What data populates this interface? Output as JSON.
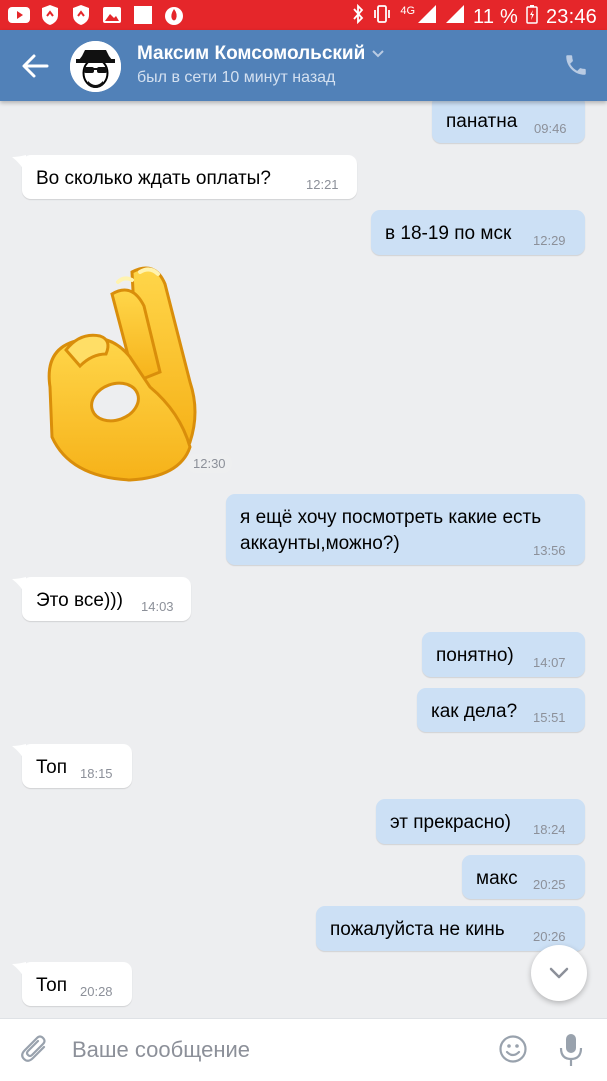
{
  "status_bar": {
    "network": "4G",
    "battery": "11 %",
    "time": "23:46"
  },
  "header": {
    "name": "Максим Комсомольский",
    "status": "был в сети 10 минут назад"
  },
  "messages": [
    {
      "dir": "out",
      "text": "панатна",
      "time": "09:46"
    },
    {
      "dir": "in",
      "text": "Во сколько ждать оплаты?",
      "time": "12:21"
    },
    {
      "dir": "out",
      "text": "в 18-19 по мск",
      "time": "12:29"
    },
    {
      "dir": "in",
      "sticker": "ok-hand",
      "time": "12:30"
    },
    {
      "dir": "out",
      "text_line1": "я ещё хочу посмотреть какие есть",
      "text_line2": "аккаунты,можно?)",
      "time": "13:56"
    },
    {
      "dir": "in",
      "text": "Это все)))",
      "time": "14:03"
    },
    {
      "dir": "out",
      "text": "понятно)",
      "time": "14:07"
    },
    {
      "dir": "out",
      "text": "как дела?",
      "time": "15:51"
    },
    {
      "dir": "in",
      "text": "Топ",
      "time": "18:15"
    },
    {
      "dir": "out",
      "text": "эт прекрасно)",
      "time": "18:24"
    },
    {
      "dir": "out",
      "text": "макс",
      "time": "20:25"
    },
    {
      "dir": "out",
      "text": "пожалуйста не кинь",
      "time": "20:26"
    },
    {
      "dir": "in",
      "text": "Топ",
      "time": "20:28"
    }
  ],
  "input": {
    "placeholder": "Ваше сообщение"
  },
  "colors": {
    "status_bar": "#e5262a",
    "header": "#5181b8",
    "background": "#edeef0",
    "outgoing_bubble": "#cce0f5",
    "incoming_bubble": "#ffffff"
  }
}
